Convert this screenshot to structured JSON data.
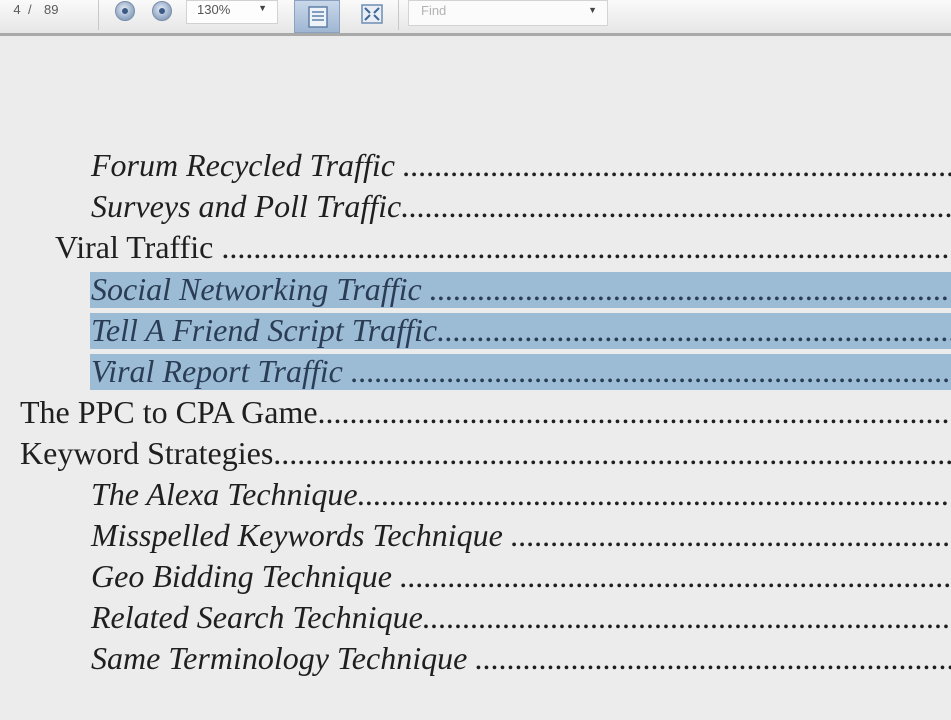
{
  "toolbar": {
    "page_current": "4",
    "page_separator": "/",
    "page_total": "89",
    "zoom_level": "130%",
    "zoom_dropdown_icon": "chevron-down-icon",
    "find_placeholder": "Find",
    "find_dropdown_icon": "chevron-down-icon",
    "fit_page_icon": "fit-page-icon",
    "full_screen_icon": "full-screen-icon"
  },
  "toc": {
    "leader": "............................................................................................................",
    "entries": [
      {
        "title": "Forum Recycled Traffic ",
        "level": 3,
        "selected": false
      },
      {
        "title": "Surveys and Poll Traffic",
        "level": 3,
        "selected": false
      },
      {
        "title": "Viral Traffic ",
        "level": 2,
        "selected": false
      },
      {
        "title": "Social Networking Traffic ",
        "level": 3,
        "selected": true
      },
      {
        "title": "Tell A Friend Script Traffic",
        "level": 3,
        "selected": true
      },
      {
        "title": "Viral Report Traffic ",
        "level": 3,
        "selected": true
      },
      {
        "title": "The PPC to CPA Game",
        "level": 1,
        "selected": false
      },
      {
        "title": "Keyword Strategies",
        "level": 1,
        "selected": false
      },
      {
        "title": "The Alexa Technique",
        "level": 3,
        "selected": false
      },
      {
        "title": "Misspelled Keywords Technique ",
        "level": 3,
        "selected": false
      },
      {
        "title": "Geo Bidding Technique ",
        "level": 3,
        "selected": false
      },
      {
        "title": "Related Search Technique",
        "level": 3,
        "selected": false
      },
      {
        "title": "Same Terminology Technique ",
        "level": 3,
        "selected": false
      }
    ]
  },
  "colors": {
    "selection": "#9cbcd6",
    "page_background": "#ececec",
    "toolbar_border": "#a9a9a9"
  }
}
